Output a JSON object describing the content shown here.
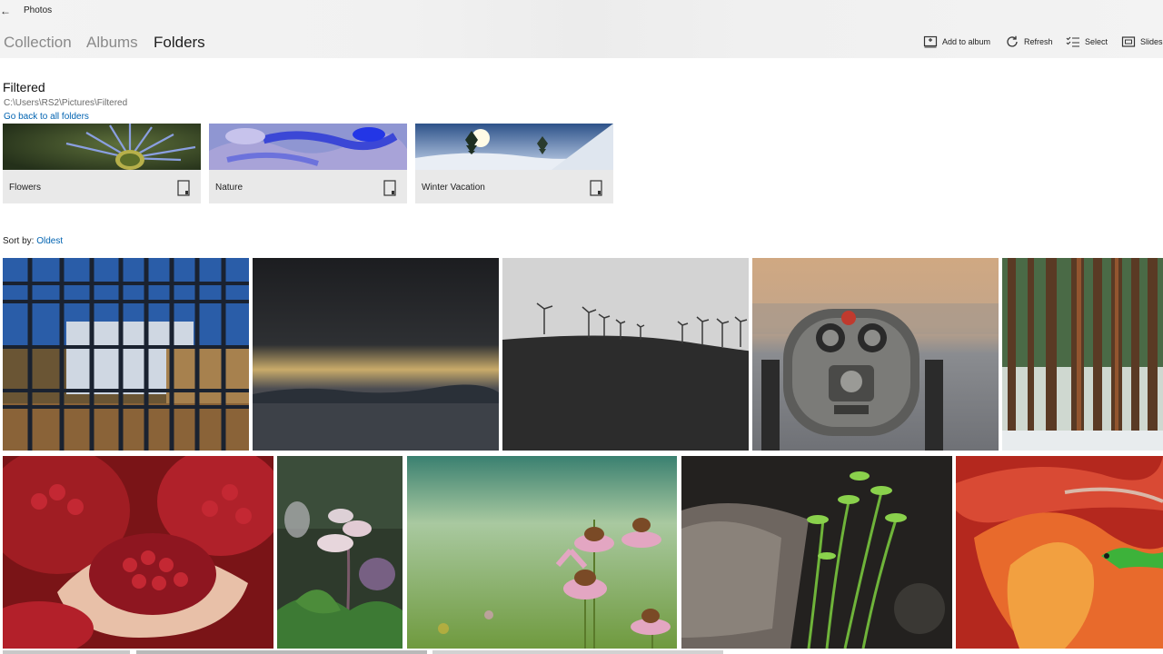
{
  "app": {
    "title": "Photos",
    "back_icon": "back-arrow-icon",
    "nav_tabs": [
      {
        "label": "Collection",
        "active": false
      },
      {
        "label": "Albums",
        "active": false
      },
      {
        "label": "Folders",
        "active": true
      }
    ],
    "toolbar": {
      "add_to_album": "Add to album",
      "refresh": "Refresh",
      "select": "Select",
      "slideshow": "Slidesh"
    }
  },
  "folder": {
    "title": "Filtered",
    "path": "C:\\Users\\RS2\\Pictures\\Filtered",
    "back_link": "Go back to all folders",
    "subfolders": [
      {
        "label": "Flowers",
        "icon": "folder-icon"
      },
      {
        "label": "Nature",
        "icon": "folder-icon"
      },
      {
        "label": "Winter Vacation",
        "icon": "folder-icon"
      }
    ]
  },
  "sort": {
    "label": "Sort by:",
    "value": "Oldest"
  },
  "photos": [
    {
      "subject": "glass-building"
    },
    {
      "subject": "sunset-sea"
    },
    {
      "subject": "wind-turbines"
    },
    {
      "subject": "coin-binoculars"
    },
    {
      "subject": "forest"
    },
    {
      "subject": "pomegranate"
    },
    {
      "subject": "white-flowers"
    },
    {
      "subject": "coneflowers"
    },
    {
      "subject": "seedlings"
    },
    {
      "subject": "gecko-leaf"
    }
  ],
  "colors": {
    "accent": "#0063b1",
    "tile_bg": "#e9e9e9",
    "header_bg": "#f2f2f2"
  }
}
